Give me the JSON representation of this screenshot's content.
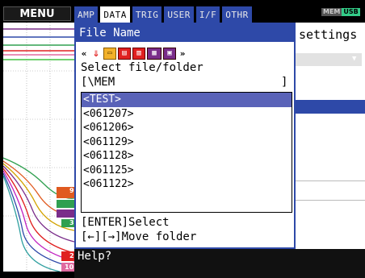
{
  "menu": {
    "label": "MENU"
  },
  "tabs": [
    {
      "label": "AMP",
      "active": false
    },
    {
      "label": "DATA",
      "active": true
    },
    {
      "label": "TRIG",
      "active": false
    },
    {
      "label": "USER",
      "active": false
    },
    {
      "label": "I/F",
      "active": false
    },
    {
      "label": "OTHR",
      "active": false
    }
  ],
  "status": {
    "mem": "MEM",
    "usb": "USB"
  },
  "background": {
    "settings_text": "settings"
  },
  "dialog": {
    "title": "File Name",
    "toolbar": {
      "back": "«",
      "down": "⇓",
      "forward": "»"
    },
    "select_label": "Select file/folder",
    "path_open": "[\\MEM",
    "path_close": "]",
    "files": [
      "<TEST>",
      "<061207>",
      "<061206>",
      "<061129>",
      "<061128>",
      "<061125>",
      "<061122>"
    ],
    "selected_index": 0,
    "hint_enter": "[ENTER]Select",
    "hint_move": "[←][→]Move folder"
  },
  "channel_markers": [
    "9",
    "3",
    "2",
    "10"
  ],
  "help": {
    "text": "Help?"
  },
  "colors": {
    "accent": "#2e49a8",
    "selected_row": "#5a63b8",
    "background": "#000000"
  }
}
